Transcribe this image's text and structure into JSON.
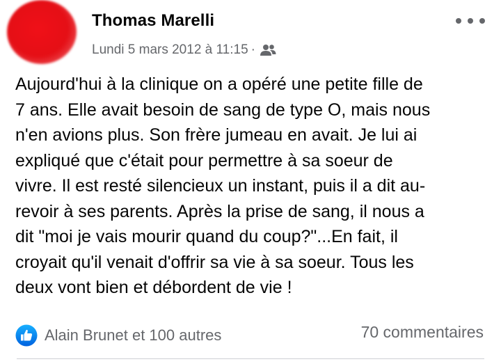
{
  "post": {
    "author": "Thomas Marelli",
    "timestamp": "Lundi 5 mars 2012 à 11:15",
    "separator": "·",
    "audience_icon": "friends-icon",
    "more_icon": "more-options-icon",
    "content": "Aujourd'hui à la clinique on a opéré une petite fille de\n7 ans. Elle avait besoin de sang de type O, mais nous\nn'en avions plus. Son frère jumeau en avait. Je lui ai\nexpliqué que c'était pour permettre à sa soeur de\nvivre. Il est resté silencieux un instant, puis il a dit au-\nrevoir à ses parents. Après la prise de sang, il nous a\ndit \"moi je vais mourir quand du coup?\"...En fait, il\ncroyait qu'il venait d'offrir sa vie à sa soeur. Tous les\ndeux vont bien et débordent de vie !",
    "reactions": {
      "icon": "like-icon",
      "text": "Alain Brunet et 100 autres"
    },
    "comments": "70 commentaires"
  },
  "colors": {
    "like_blue": "#1877f2",
    "secondary_text": "#65676b",
    "primary_text": "#050505",
    "avatar_red": "#e50f16"
  }
}
